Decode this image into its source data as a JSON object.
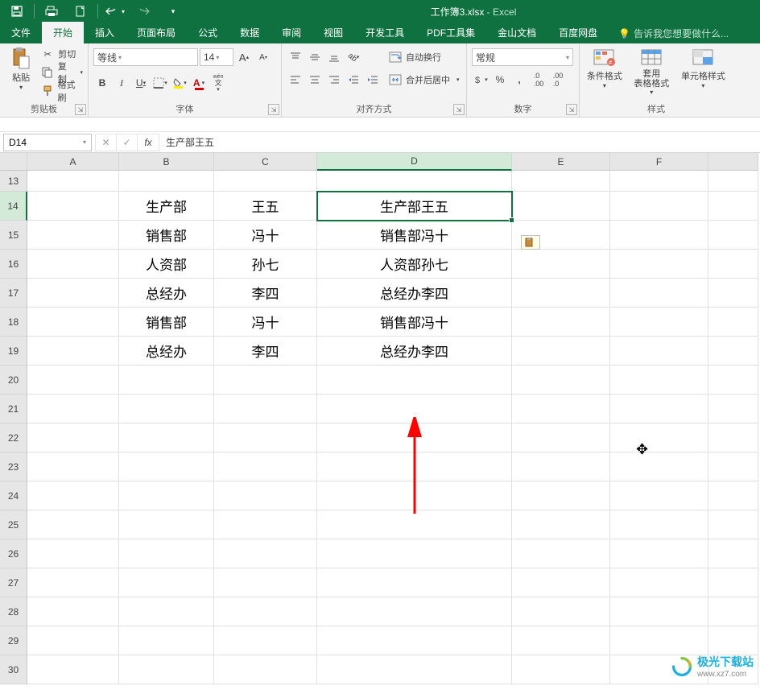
{
  "title": {
    "filename": "工作簿3.xlsx",
    "app": "Excel"
  },
  "menu": {
    "file": "文件",
    "home": "开始",
    "insert": "插入",
    "pagelayout": "页面布局",
    "formulas": "公式",
    "data": "数据",
    "review": "审阅",
    "view": "视图",
    "dev": "开发工具",
    "pdf": "PDF工具集",
    "jinshan": "金山文档",
    "baidu": "百度网盘",
    "tellme": "告诉我您想要做什么..."
  },
  "ribbon": {
    "clipboard": {
      "paste": "粘贴",
      "cut": "剪切",
      "copy": "复制",
      "format_painter": "格式刷",
      "label": "剪贴板"
    },
    "font": {
      "name": "等线",
      "size": "14",
      "label": "字体"
    },
    "alignment": {
      "wrap": "自动换行",
      "merge": "合并后居中",
      "label": "对齐方式"
    },
    "number": {
      "format": "常规",
      "label": "数字"
    },
    "styles": {
      "cond": "条件格式",
      "table": "套用\n表格格式",
      "cell": "单元格样式",
      "label": "样式"
    }
  },
  "formula_bar": {
    "name_box": "D14",
    "formula": "生产部王五"
  },
  "columns": [
    "A",
    "B",
    "C",
    "D",
    "E",
    "F"
  ],
  "rows": [
    13,
    14,
    15,
    16,
    17,
    18,
    19,
    20,
    21,
    22,
    23,
    24,
    25,
    26,
    27,
    28,
    29,
    30
  ],
  "active_col": "D",
  "active_row": 14,
  "cells": {
    "14": {
      "B": "生产部",
      "C": "王五",
      "D": "生产部王五"
    },
    "15": {
      "B": "销售部",
      "C": "冯十",
      "D": "销售部冯十"
    },
    "16": {
      "B": "人资部",
      "C": "孙七",
      "D": "人资部孙七"
    },
    "17": {
      "B": "总经办",
      "C": "李四",
      "D": "总经办李四"
    },
    "18": {
      "B": "销售部",
      "C": "冯十",
      "D": "销售部冯十"
    },
    "19": {
      "B": "总经办",
      "C": "李四",
      "D": "总经办李四"
    }
  },
  "watermark": {
    "text": "极光下载站",
    "url": "www.xz7.com"
  }
}
